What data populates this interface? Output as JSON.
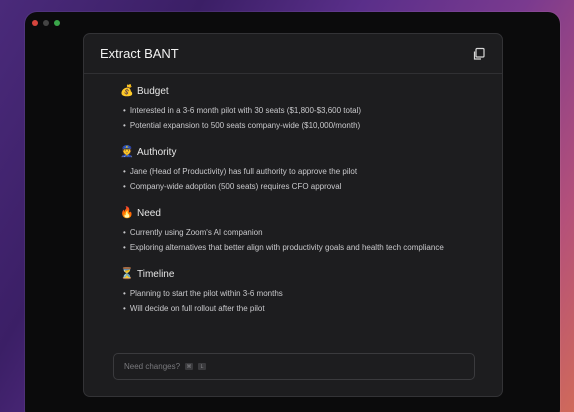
{
  "panel": {
    "title": "Extract BANT",
    "copy_icon": "copy-icon"
  },
  "sections": [
    {
      "emoji": "💰",
      "title": "Budget",
      "items": [
        "Interested in a 3-6 month pilot with 30 seats ($1,800-$3,600 total)",
        "Potential expansion to 500 seats company-wide ($10,000/month)"
      ]
    },
    {
      "emoji": "👮",
      "title": "Authority",
      "items": [
        "Jane (Head of Productivity) has full authority to approve the pilot",
        "Company-wide adoption (500 seats) requires CFO approval"
      ]
    },
    {
      "emoji": "🔥",
      "title": "Need",
      "items": [
        "Currently using Zoom's AI companion",
        "Exploring alternatives that better align with productivity goals and health tech compliance"
      ]
    },
    {
      "emoji": "⏳",
      "title": "Timeline",
      "items": [
        "Planning to start the pilot within 3-6 months",
        "Will decide on full rollout after the pilot"
      ]
    }
  ],
  "input": {
    "placeholder": "Need changes?",
    "shortcut_keys": [
      "⌘",
      "L"
    ]
  },
  "colors": {
    "panel_bg": "#1d1d1f",
    "window_bg": "#0b0b0c",
    "traffic_red": "#d6453d",
    "traffic_green": "#3aa64a"
  }
}
